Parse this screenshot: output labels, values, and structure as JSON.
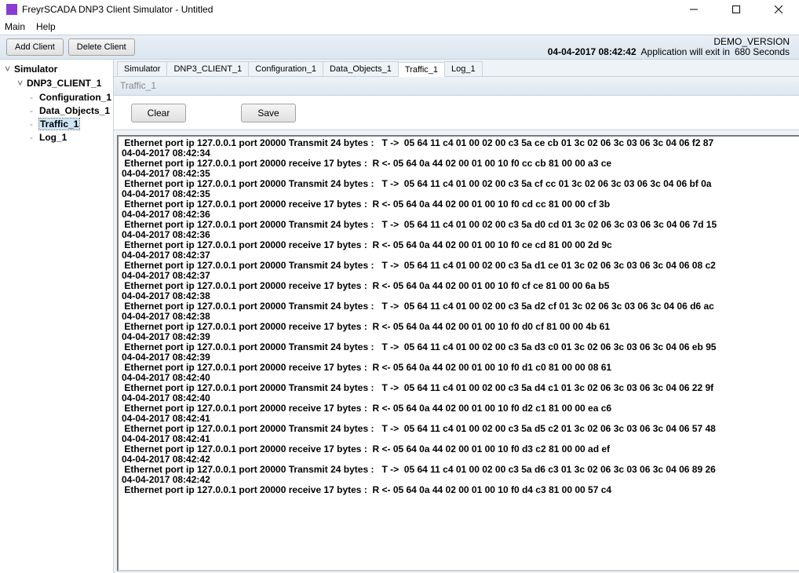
{
  "window": {
    "title": "FreyrSCADA DNP3 Client Simulator - Untitled"
  },
  "menu": {
    "main": "Main",
    "help": "Help"
  },
  "toolbar": {
    "add": "Add Client",
    "delete": "Delete Client"
  },
  "status": {
    "demo": "DEMO_VERSION",
    "datetime": "04-04-2017 08:42:42",
    "exit_label": "Application will exit in",
    "seconds": "680  Seconds"
  },
  "tree": {
    "root": "Simulator",
    "client": "DNP3_CLIENT_1",
    "nodes": {
      "config": "Configuration_1",
      "dataobj": "Data_Objects_1",
      "traffic": "Traffic_1",
      "log": "Log_1"
    }
  },
  "tabs": {
    "simulator": "Simulator",
    "client": "DNP3_CLIENT_1",
    "config": "Configuration_1",
    "dataobj": "Data_Objects_1",
    "traffic": "Traffic_1",
    "log": "Log_1"
  },
  "panel": {
    "subheader": "Traffic_1",
    "clear": "Clear",
    "save": "Save"
  },
  "traffic": [
    {
      "msg": " Ethernet port ip 127.0.0.1 port 20000 Transmit 24 bytes :   T ->  05 64 11 c4 01 00 02 00 c3 5a ce cb 01 3c 02 06 3c 03 06 3c 04 06 f2 87",
      "ts": "04-04-2017 08:42:34"
    },
    {
      "msg": " Ethernet port ip 127.0.0.1 port 20000 receive 17 bytes :  R <- 05 64 0a 44 02 00 01 00 10 f0 cc cb 81 00 00 a3 ce",
      "ts": "04-04-2017 08:42:35"
    },
    {
      "msg": " Ethernet port ip 127.0.0.1 port 20000 Transmit 24 bytes :   T ->  05 64 11 c4 01 00 02 00 c3 5a cf cc 01 3c 02 06 3c 03 06 3c 04 06 bf 0a",
      "ts": "04-04-2017 08:42:35"
    },
    {
      "msg": " Ethernet port ip 127.0.0.1 port 20000 receive 17 bytes :  R <- 05 64 0a 44 02 00 01 00 10 f0 cd cc 81 00 00 cf 3b",
      "ts": "04-04-2017 08:42:36"
    },
    {
      "msg": " Ethernet port ip 127.0.0.1 port 20000 Transmit 24 bytes :   T ->  05 64 11 c4 01 00 02 00 c3 5a d0 cd 01 3c 02 06 3c 03 06 3c 04 06 7d 15",
      "ts": "04-04-2017 08:42:36"
    },
    {
      "msg": " Ethernet port ip 127.0.0.1 port 20000 receive 17 bytes :  R <- 05 64 0a 44 02 00 01 00 10 f0 ce cd 81 00 00 2d 9c",
      "ts": "04-04-2017 08:42:37"
    },
    {
      "msg": " Ethernet port ip 127.0.0.1 port 20000 Transmit 24 bytes :   T ->  05 64 11 c4 01 00 02 00 c3 5a d1 ce 01 3c 02 06 3c 03 06 3c 04 06 08 c2",
      "ts": "04-04-2017 08:42:37"
    },
    {
      "msg": " Ethernet port ip 127.0.0.1 port 20000 receive 17 bytes :  R <- 05 64 0a 44 02 00 01 00 10 f0 cf ce 81 00 00 6a b5",
      "ts": "04-04-2017 08:42:38"
    },
    {
      "msg": " Ethernet port ip 127.0.0.1 port 20000 Transmit 24 bytes :   T ->  05 64 11 c4 01 00 02 00 c3 5a d2 cf 01 3c 02 06 3c 03 06 3c 04 06 d6 ac",
      "ts": "04-04-2017 08:42:38"
    },
    {
      "msg": " Ethernet port ip 127.0.0.1 port 20000 receive 17 bytes :  R <- 05 64 0a 44 02 00 01 00 10 f0 d0 cf 81 00 00 4b 61",
      "ts": "04-04-2017 08:42:39"
    },
    {
      "msg": " Ethernet port ip 127.0.0.1 port 20000 Transmit 24 bytes :   T ->  05 64 11 c4 01 00 02 00 c3 5a d3 c0 01 3c 02 06 3c 03 06 3c 04 06 eb 95",
      "ts": "04-04-2017 08:42:39"
    },
    {
      "msg": " Ethernet port ip 127.0.0.1 port 20000 receive 17 bytes :  R <- 05 64 0a 44 02 00 01 00 10 f0 d1 c0 81 00 00 08 61",
      "ts": "04-04-2017 08:42:40"
    },
    {
      "msg": " Ethernet port ip 127.0.0.1 port 20000 Transmit 24 bytes :   T ->  05 64 11 c4 01 00 02 00 c3 5a d4 c1 01 3c 02 06 3c 03 06 3c 04 06 22 9f",
      "ts": "04-04-2017 08:42:40"
    },
    {
      "msg": " Ethernet port ip 127.0.0.1 port 20000 receive 17 bytes :  R <- 05 64 0a 44 02 00 01 00 10 f0 d2 c1 81 00 00 ea c6",
      "ts": "04-04-2017 08:42:41"
    },
    {
      "msg": " Ethernet port ip 127.0.0.1 port 20000 Transmit 24 bytes :   T ->  05 64 11 c4 01 00 02 00 c3 5a d5 c2 01 3c 02 06 3c 03 06 3c 04 06 57 48",
      "ts": "04-04-2017 08:42:41"
    },
    {
      "msg": " Ethernet port ip 127.0.0.1 port 20000 receive 17 bytes :  R <- 05 64 0a 44 02 00 01 00 10 f0 d3 c2 81 00 00 ad ef",
      "ts": "04-04-2017 08:42:42"
    },
    {
      "msg": " Ethernet port ip 127.0.0.1 port 20000 Transmit 24 bytes :   T ->  05 64 11 c4 01 00 02 00 c3 5a d6 c3 01 3c 02 06 3c 03 06 3c 04 06 89 26",
      "ts": "04-04-2017 08:42:42"
    },
    {
      "msg": " Ethernet port ip 127.0.0.1 port 20000 receive 17 bytes :  R <- 05 64 0a 44 02 00 01 00 10 f0 d4 c3 81 00 00 57 c4",
      "ts": ""
    }
  ]
}
